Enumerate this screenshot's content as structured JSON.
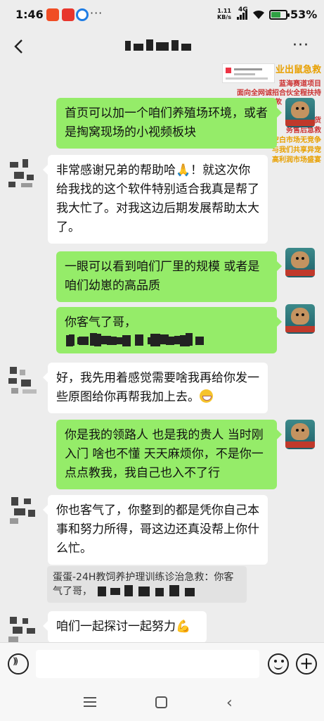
{
  "status_bar": {
    "time": "1:46",
    "network_speed": "1.11\nKB/s",
    "network_type": "4G",
    "battery_percent": "53%"
  },
  "header": {
    "back_icon": "chevron-left-icon",
    "title": "",
    "more_icon": "more-dots-icon"
  },
  "promo": {
    "lines": [
      "业出鼠急救",
      "蓝海赛道项目",
      "面向全网诚招合伙全程扶持",
      "款",
      "化掏窝新货",
      "务售后急救",
      "小众异宠类空白市场无竞争",
      "与我们共享异宠",
      "高利润市场盛宴"
    ]
  },
  "messages": [
    {
      "side": "me",
      "text": "首页可以加一个咱们养殖场环境，或者是掏窝现场的小视频板块"
    },
    {
      "side": "them",
      "text": "非常感谢兄弟的帮助哈",
      "emoji": "🙏",
      "text2": "！就这次你给我找的这个软件特别适合我真是帮了我大忙了。对我这边后期发展帮助太大了。"
    },
    {
      "side": "me",
      "text": "一眼可以看到咱们厂里的规模 或者是咱们幼崽的高品质"
    },
    {
      "side": "me",
      "text": "你客气了哥，"
    },
    {
      "side": "them",
      "text": "好，我先用着感觉需要啥我再给你发一些原图给你再帮我加上去。"
    },
    {
      "side": "me",
      "text": "你是我的领路人  也是我的贵人  当时刚入门 啥也不懂 天天麻烦你，不是你一点点教我，我自己也入不了行"
    },
    {
      "side": "them",
      "text": "你也客气了，你整到的都是凭你自己本事和努力所得，哥这边还真没帮上你什么忙。"
    },
    {
      "side": "quote",
      "text": "蛋蛋-24H教饲养护理训练诊治急救：你客气了哥，"
    },
    {
      "side": "them",
      "text": "咱们一起探讨一起努力",
      "emoji": "💪"
    }
  ],
  "input_bar": {
    "voice_icon": "voice-icon",
    "emoji_icon": "emoji-icon",
    "plus_icon": "plus-icon",
    "value": ""
  },
  "nav_bar": {
    "menu_icon": "menu-icon",
    "home_icon": "home-icon",
    "back_icon": "back-icon"
  }
}
